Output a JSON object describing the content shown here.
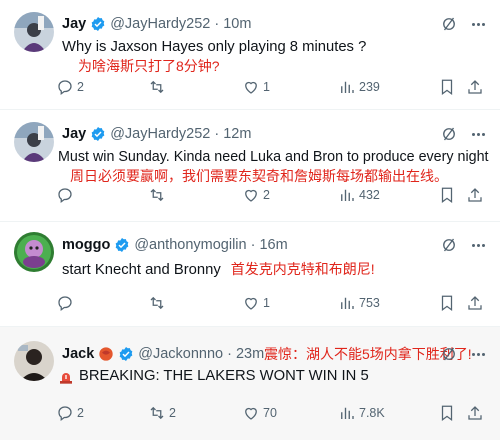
{
  "tweets": [
    {
      "name": "Jay",
      "handle": "@JayHardy252",
      "time": "10m",
      "text": "Why is Jaxson Hayes only playing 8 minutes ?",
      "translation": "为啥海斯只打了8分钟?",
      "replies": "2",
      "retweets": "",
      "likes": "1",
      "views": "239"
    },
    {
      "name": "Jay",
      "handle": "@JayHardy252",
      "time": "12m",
      "text": "Must win Sunday. Kinda need Luka and Bron to produce every night",
      "translation": "周日必须要赢啊，我们需要东契奇和詹姆斯每场都输出在线。",
      "replies": "",
      "retweets": "",
      "likes": "2",
      "views": "432"
    },
    {
      "name": "moggo",
      "handle": "@anthonymogilin",
      "time": "16m",
      "text": "start Knecht and Bronny",
      "translation": "首发克内克特和布朗尼!",
      "replies": "",
      "retweets": "",
      "likes": "1",
      "views": "753"
    },
    {
      "name": "Jack",
      "handle": "@Jackonnno",
      "time": "23m",
      "text": "BREAKING: THE LAKERS WONT WIN IN 5",
      "translation": "震惊：湖人不能5场内拿下胜利了!",
      "replies": "2",
      "retweets": "2",
      "likes": "70",
      "views": "7.8K"
    }
  ],
  "separator": "·",
  "colors": {
    "verified_blue": "#1d9bf0",
    "translation_red": "#e0261c",
    "secondary_text": "#536471",
    "highlight_bg": "#f7f7f7"
  },
  "icons": [
    "verified-badge-icon",
    "grok-icon",
    "more-icon",
    "reply-icon",
    "retweet-icon",
    "like-icon",
    "views-icon",
    "bookmark-icon",
    "share-icon",
    "siren-icon",
    "flag-icon"
  ]
}
